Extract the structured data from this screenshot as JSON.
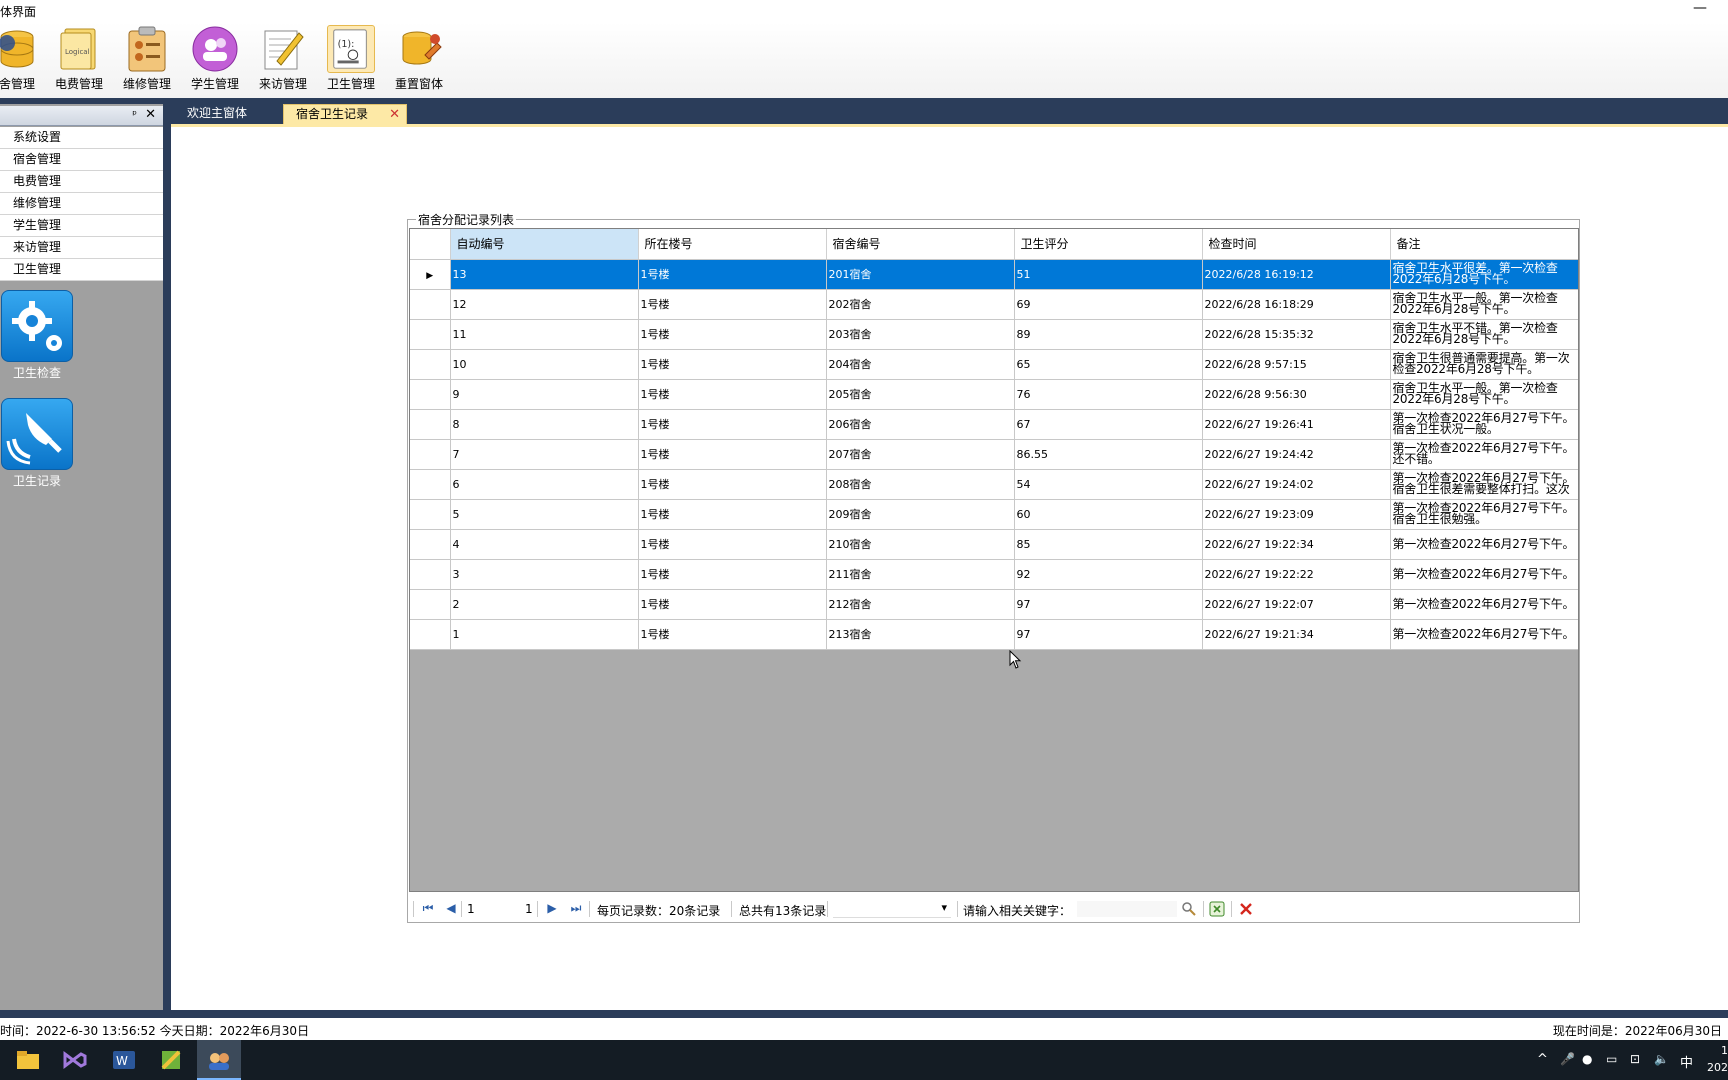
{
  "window": {
    "title": "体界面",
    "minimize": "—"
  },
  "toolbar": {
    "buttons": [
      {
        "label": "舍管理",
        "icon": "database-icon"
      },
      {
        "label": "电费管理",
        "icon": "notebook-icon"
      },
      {
        "label": "维修管理",
        "icon": "clipboard-icon"
      },
      {
        "label": "学生管理",
        "icon": "students-icon"
      },
      {
        "label": "来访管理",
        "icon": "edit-document-icon"
      },
      {
        "label": "卫生管理",
        "icon": "checklist-icon"
      },
      {
        "label": "重置窗体",
        "icon": "database-settings-icon"
      }
    ]
  },
  "dock": {
    "pin": "ᵖ",
    "close": "✕",
    "nav": [
      "系统设置",
      "宿舍管理",
      "电费管理",
      "维修管理",
      "学生管理",
      "来访管理",
      "卫生管理"
    ],
    "tiles": [
      {
        "label": "卫生检查",
        "icon": "gear-icon"
      },
      {
        "label": "卫生记录",
        "icon": "bell-icon"
      }
    ]
  },
  "tabs": [
    {
      "label": "欢迎主窗体",
      "active": false
    },
    {
      "label": "宿舍卫生记录",
      "active": true,
      "close": "✕"
    }
  ],
  "group": {
    "title": "宿舍分配记录列表"
  },
  "grid": {
    "columns": [
      "自动编号",
      "所在楼号",
      "宿舍编号",
      "卫生评分",
      "检查时间",
      "备注"
    ],
    "rows": [
      {
        "id": "13",
        "building": "1号楼",
        "room": "201宿舍",
        "score": "51",
        "time": "2022/6/28 16:19:12",
        "note": "宿舍卫生水平很差。第一次检查2022年6月28号下午。"
      },
      {
        "id": "12",
        "building": "1号楼",
        "room": "202宿舍",
        "score": "69",
        "time": "2022/6/28 16:18:29",
        "note": "宿舍卫生水平一般。第一次检查2022年6月28号下午。"
      },
      {
        "id": "11",
        "building": "1号楼",
        "room": "203宿舍",
        "score": "89",
        "time": "2022/6/28 15:35:32",
        "note": "宿舍卫生水平不错。第一次检查2022年6月28号下午。"
      },
      {
        "id": "10",
        "building": "1号楼",
        "room": "204宿舍",
        "score": "65",
        "time": "2022/6/28 9:57:15",
        "note": "宿舍卫生很普通需要提高。第一次检查2022年6月28号下午。"
      },
      {
        "id": "9",
        "building": "1号楼",
        "room": "205宿舍",
        "score": "76",
        "time": "2022/6/28 9:56:30",
        "note": "宿舍卫生水平一般。第一次检查2022年6月28号下午。"
      },
      {
        "id": "8",
        "building": "1号楼",
        "room": "206宿舍",
        "score": "67",
        "time": "2022/6/27 19:26:41",
        "note": "第一次检查2022年6月27号下午。宿舍卫生状况一般。"
      },
      {
        "id": "7",
        "building": "1号楼",
        "room": "207宿舍",
        "score": "86.55",
        "time": "2022/6/27 19:24:42",
        "note": "第一次检查2022年6月27号下午。还不错。"
      },
      {
        "id": "6",
        "building": "1号楼",
        "room": "208宿舍",
        "score": "54",
        "time": "2022/6/27 19:24:02",
        "note": "第一次检查2022年6月27号下午。宿舍卫生很差需要整体打扫。这次"
      },
      {
        "id": "5",
        "building": "1号楼",
        "room": "209宿舍",
        "score": "60",
        "time": "2022/6/27 19:23:09",
        "note": "第一次检查2022年6月27号下午。宿舍卫生很勉强。"
      },
      {
        "id": "4",
        "building": "1号楼",
        "room": "210宿舍",
        "score": "85",
        "time": "2022/6/27 19:22:34",
        "note": "第一次检查2022年6月27号下午。"
      },
      {
        "id": "3",
        "building": "1号楼",
        "room": "211宿舍",
        "score": "92",
        "time": "2022/6/27 19:22:22",
        "note": "第一次检查2022年6月27号下午。"
      },
      {
        "id": "2",
        "building": "1号楼",
        "room": "212宿舍",
        "score": "97",
        "time": "2022/6/27 19:22:07",
        "note": "第一次检查2022年6月27号下午。"
      },
      {
        "id": "1",
        "building": "1号楼",
        "room": "213宿舍",
        "score": "97",
        "time": "2022/6/27 19:21:34",
        "note": "第一次检查2022年6月27号下午。"
      }
    ]
  },
  "pager": {
    "first": "⏮",
    "prev": "◀",
    "next": "▶",
    "last": "⏭",
    "page_value": "1",
    "page_total": "1",
    "per_page": "每页记录数：20条记录",
    "total": "总共有13条记录",
    "dropdown_arrow": "▾",
    "keyword_label": "请输入相关关键字：",
    "keyword_value": ""
  },
  "status": {
    "left": "时间：2022-6-30 13:56:52   今天日期：2022年6月30日",
    "right": "现在时间是：2022年06月30日"
  },
  "taskbar": {
    "tray": [
      "^",
      "中"
    ],
    "clock_time": "1",
    "clock_date": "202"
  },
  "colors": {
    "selection": "#0078d7",
    "band": "#2b3d5a",
    "tab_active": "#fde9a6",
    "tile": "#0a74c9"
  }
}
